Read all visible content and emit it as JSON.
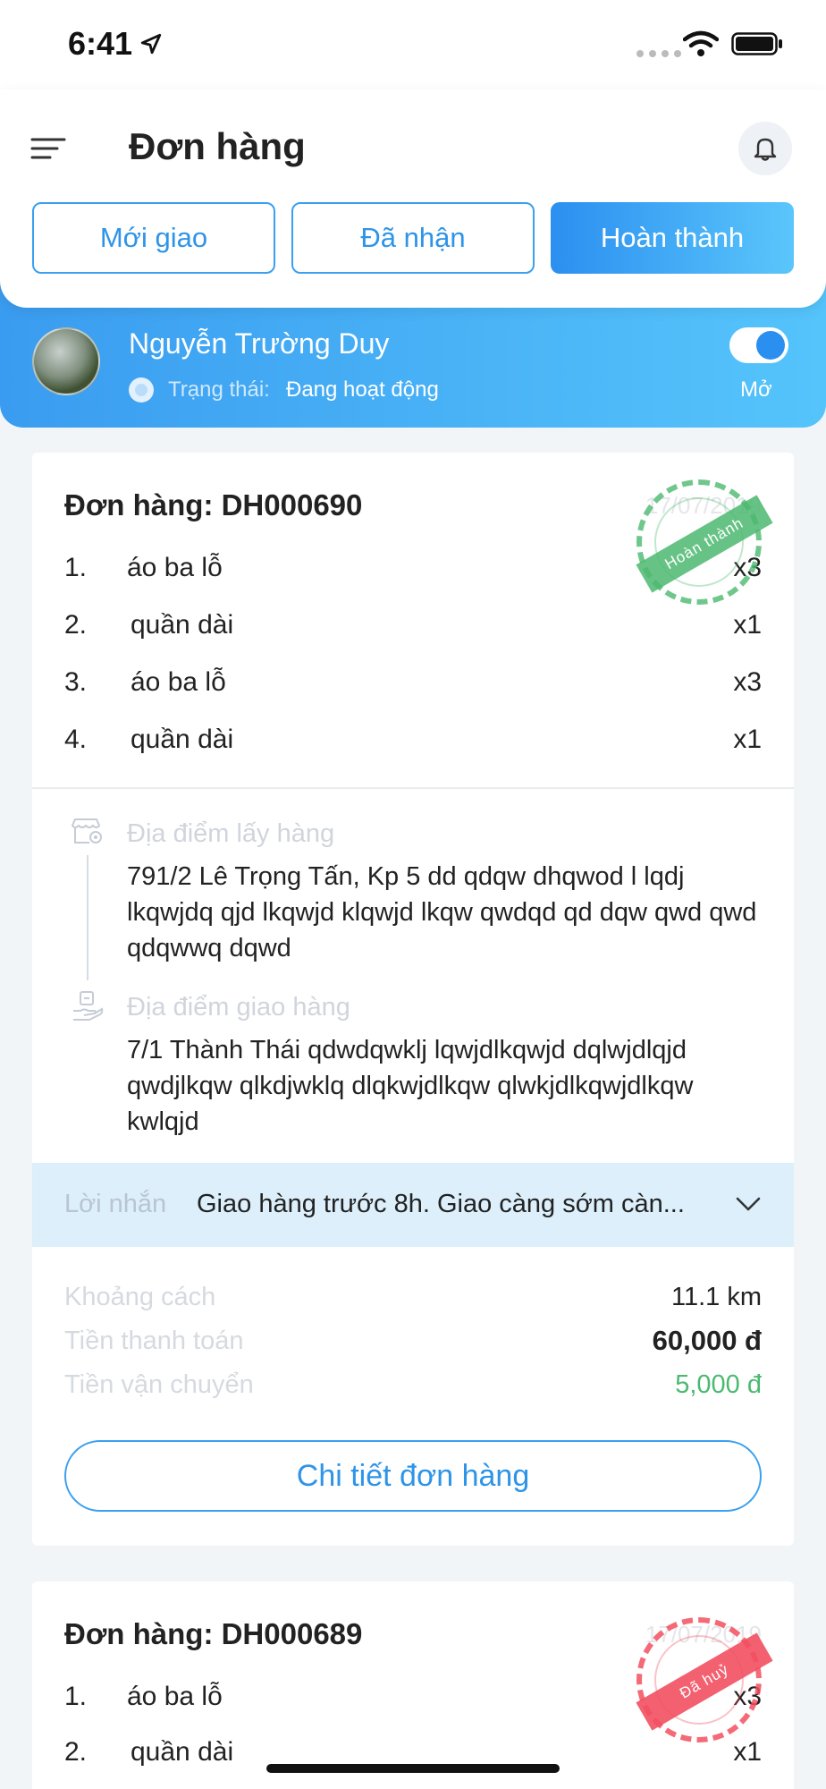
{
  "status_bar": {
    "time": "6:41"
  },
  "header": {
    "title": "Đơn hàng",
    "tabs": [
      {
        "label": "Mới giao",
        "active": false
      },
      {
        "label": "Đã nhận",
        "active": false
      },
      {
        "label": "Hoàn thành",
        "active": true
      }
    ]
  },
  "user": {
    "name": "Nguyễn Trường Duy",
    "status_label": "Trạng thái:",
    "status_value": "Đang hoạt động",
    "toggle_on": true,
    "toggle_label": "Mở"
  },
  "orders": [
    {
      "id": "Đơn hàng: DH000690",
      "date": "17/07/2019",
      "stamp": "Hoàn thành",
      "stamp_color": "#4cb970",
      "items": [
        {
          "num": "1.",
          "name": "áo ba lỗ",
          "qty": "x3"
        },
        {
          "num": "2.",
          "name": "quần dài",
          "qty": "x1"
        },
        {
          "num": "3.",
          "name": "áo ba lỗ",
          "qty": "x3"
        },
        {
          "num": "4.",
          "name": "quần dài",
          "qty": "x1"
        }
      ],
      "pickup_label": "Địa điểm lấy hàng",
      "pickup_address": "791/2 Lê Trọng Tấn, Kp 5 dd qdqw dhqwod l lqdj lkqwjdq qjd lkqwjd klqwjd lkqw qwdqd qd dqw qwd qwd qdqwwq dqwd",
      "delivery_label": "Địa điểm giao hàng",
      "delivery_address": "7/1 Thành Thái qdwdqwklj lqwjdlkqwjd dqlwjdlqjd qwdjlkqw qlkdjwklq dlqkwjdlkqw qlwkjdlkqwjdlkqw kwlqjd",
      "note_label": "Lời nhắn",
      "note_text": "Giao hàng trước 8h. Giao càng sớm càn...",
      "distance_label": "Khoảng cách",
      "distance_value": "11.1 km",
      "payment_label": "Tiền thanh toán",
      "payment_value": "60,000 đ",
      "shipping_label": "Tiền vận chuyển",
      "shipping_value": "5,000 đ",
      "shipping_color": "#4cb970",
      "detail_button": "Chi tiết đơn hàng"
    },
    {
      "id": "Đơn hàng: DH000689",
      "date": "17/07/2019",
      "stamp": "Đã huỷ",
      "stamp_color": "#f25060",
      "items": [
        {
          "num": "1.",
          "name": "áo ba lỗ",
          "qty": "x3"
        },
        {
          "num": "2.",
          "name": "quần dài",
          "qty": "x1"
        }
      ]
    }
  ],
  "colors": {
    "primary": "#2e94e8",
    "gradient_start": "#2b8ff0",
    "gradient_end": "#5ac6fb",
    "note_bg": "#dceffb"
  }
}
